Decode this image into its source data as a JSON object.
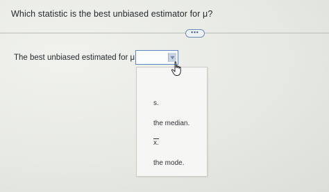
{
  "question": {
    "text": "Which statistic is the best unbiased estimator for μ?"
  },
  "more_button": {
    "label": "•••"
  },
  "answer": {
    "prompt": "The best unbiased estimated for μ is",
    "selected_value": ""
  },
  "dropdown": {
    "options": [
      "s.",
      "the median.",
      "x.",
      "the mode."
    ]
  },
  "icons": {
    "select_arrow": "chevron-down-icon",
    "cursor": "hand-pointer-icon"
  },
  "colors": {
    "accent": "#5b86c4",
    "background": "#e9ebe6"
  }
}
